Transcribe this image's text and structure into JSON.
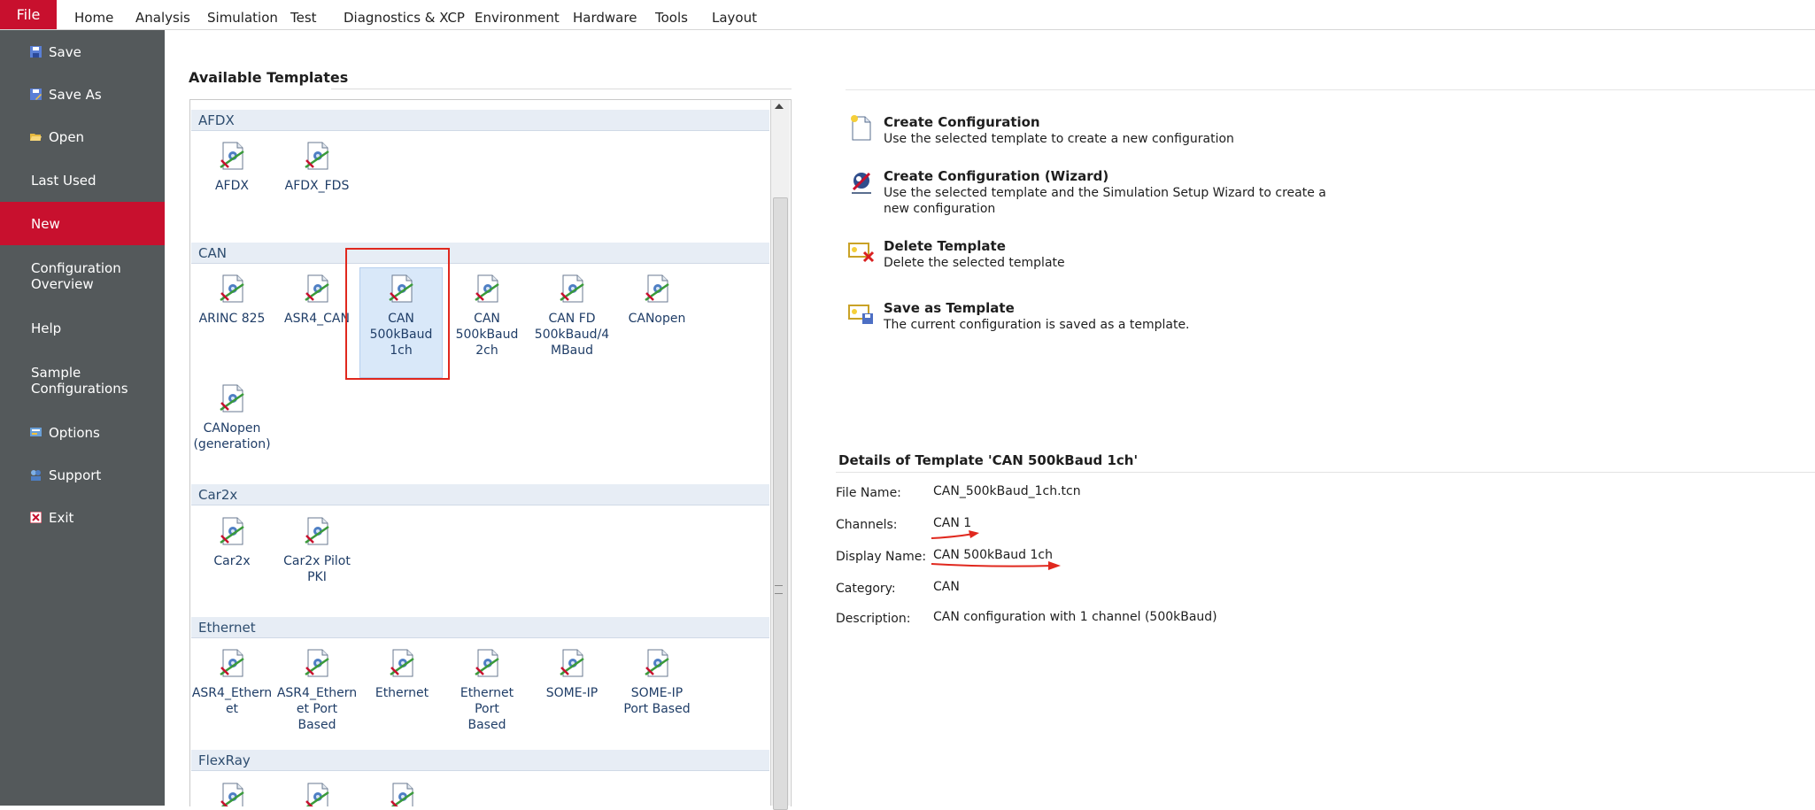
{
  "menubar": {
    "file": "File",
    "items": [
      "Home",
      "Analysis",
      "Simulation",
      "Test",
      "Diagnostics & XCP",
      "Environment",
      "Hardware",
      "Tools",
      "Layout"
    ]
  },
  "sidebar": {
    "items": [
      {
        "label": "Save",
        "icon": "save-icon"
      },
      {
        "label": "Save As",
        "icon": "save-as-icon"
      },
      {
        "label": "Open",
        "icon": "folder-open-icon"
      },
      {
        "label": "Last Used"
      },
      {
        "label": "New",
        "active": true
      },
      {
        "label": "Configuration\nOverview"
      },
      {
        "label": "Help"
      },
      {
        "label": "Sample\nConfigurations"
      },
      {
        "label": "Options",
        "icon": "options-icon"
      },
      {
        "label": "Support",
        "icon": "support-icon"
      },
      {
        "label": "Exit",
        "icon": "exit-icon"
      }
    ]
  },
  "templates": {
    "title": "Available Templates",
    "groups": [
      {
        "name": "AFDX",
        "items": [
          "AFDX",
          "AFDX_FDS"
        ]
      },
      {
        "name": "CAN",
        "items": [
          "ARINC 825",
          "ASR4_CAN",
          "CAN\n500kBaud\n1ch",
          "CAN\n500kBaud\n2ch",
          "CAN FD\n500kBaud/4\nMBaud",
          "CANopen",
          "CANopen\n(generation)"
        ]
      },
      {
        "name": "Car2x",
        "items": [
          "Car2x",
          "Car2x Pilot\nPKI"
        ]
      },
      {
        "name": "Ethernet",
        "items": [
          "ASR4_Ethern\net",
          "ASR4_Ethern\net Port\nBased",
          "Ethernet",
          "Ethernet Port\nBased",
          "SOME-IP",
          "SOME-IP\nPort Based"
        ]
      },
      {
        "name": "FlexRay",
        "items": [
          "",
          "",
          ""
        ]
      }
    ]
  },
  "actions": {
    "create": {
      "title": "Create Configuration",
      "desc": "Use the selected template to create a new configuration"
    },
    "wizard": {
      "title": "Create Configuration (Wizard)",
      "desc": "Use the selected template and the Simulation Setup Wizard to create a new configuration"
    },
    "delete": {
      "title": "Delete Template",
      "desc": "Delete the selected template"
    },
    "save": {
      "title": "Save as Template",
      "desc": "The current configuration is saved as a template."
    }
  },
  "details": {
    "title": "Details of Template 'CAN 500kBaud 1ch'",
    "labels": {
      "file_name": "File Name:",
      "channels": "Channels:",
      "display_name": "Display Name:",
      "category": "Category:",
      "description": "Description:"
    },
    "values": {
      "file_name": "CAN_500kBaud_1ch.tcn",
      "channels": "CAN 1",
      "display_name": "CAN 500kBaud 1ch",
      "category": "CAN",
      "description": "CAN configuration with 1 channel (500kBaud)"
    }
  },
  "colors": {
    "accent": "#c8102e",
    "sidebar": "#54595b",
    "group_header": "#e7edf5",
    "annotation": "#e0281e"
  }
}
